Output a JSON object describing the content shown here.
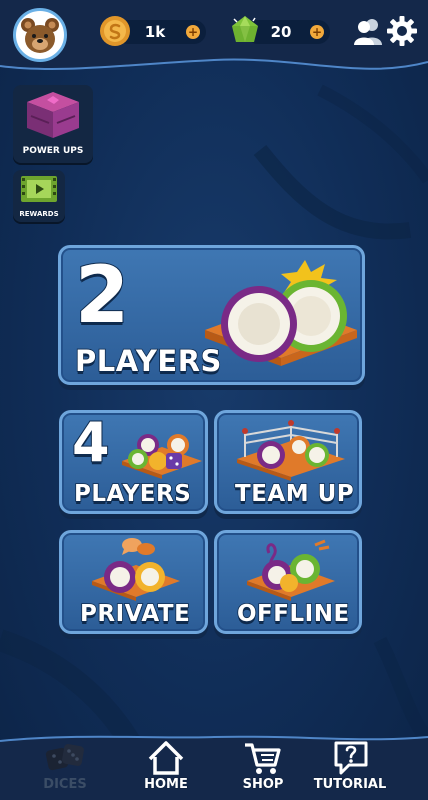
{
  "header": {
    "coins": "1k",
    "gems": "20",
    "plus": "+"
  },
  "side": {
    "power_ups": "POWER UPS",
    "rewards": "REWARDS"
  },
  "modes": {
    "two_number": "2",
    "two_label": "PLAYERS",
    "four_number": "4",
    "four_label": "PLAYERS",
    "team_label": "TEAM UP",
    "private_label": "PRIVATE",
    "offline_label": "OFFLINE"
  },
  "nav": {
    "items": [
      {
        "label": "DICES",
        "icon": "dice-icon",
        "active": true
      },
      {
        "label": "HOME",
        "icon": "home-icon"
      },
      {
        "label": "SHOP",
        "icon": "cart-icon"
      },
      {
        "label": "TUTORIAL",
        "icon": "help-icon"
      }
    ]
  },
  "colors": {
    "background": "#0f2b52",
    "card": "#3a6fad",
    "card_border": "#6fa6dc",
    "board": "#e07a2a",
    "purple_ring": "#7a2a86",
    "green_ring": "#7ab83a",
    "gold": "#f2b32c"
  }
}
